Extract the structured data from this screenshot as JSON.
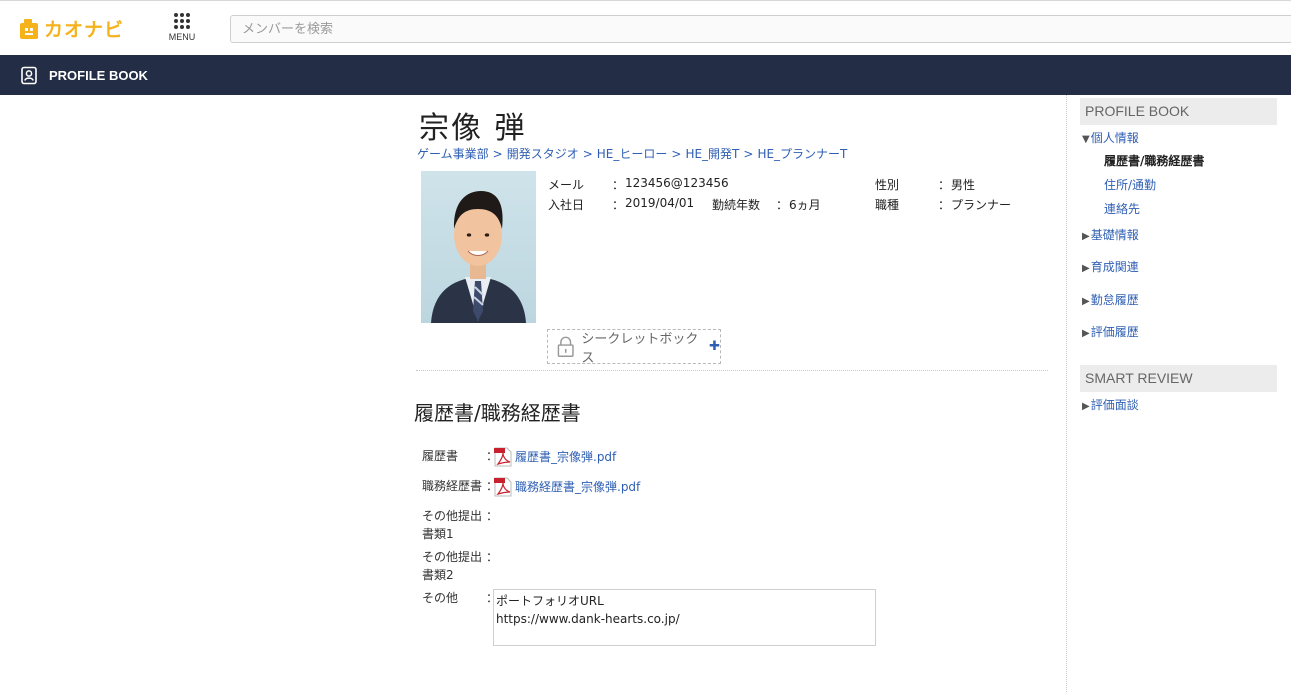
{
  "header": {
    "logo_text": "カオナビ",
    "menu_label": "MENU",
    "search_placeholder": "メンバーを検索"
  },
  "navbar": {
    "title": "PROFILE BOOK"
  },
  "profile": {
    "name": "宗像 弾",
    "breadcrumb": [
      "ゲーム事業部",
      "開発スタジオ",
      "HE_ヒーロー",
      "HE_開発T",
      "HE_プランナーT"
    ],
    "breadcrumb_sep": ">",
    "fields": {
      "email_label": "メール",
      "email_value": "123456@123456",
      "join_label": "入社日",
      "join_value": "2019/04/01",
      "tenure_label": "勤続年数",
      "tenure_value": "6ヵ月",
      "gender_label": "性別",
      "gender_value": "男性",
      "job_label": "職種",
      "job_value": "プランナー",
      "colon": "："
    },
    "secret_box_label": "シークレットボックス",
    "secret_box_plus": "✚"
  },
  "section": {
    "title": "履歴書/職務経歴書",
    "rows": [
      {
        "label": "履歴書",
        "value": "履歴書_宗像弾.pdf",
        "type": "pdf"
      },
      {
        "label": "職務経歴書",
        "value": "職務経歴書_宗像弾.pdf",
        "type": "pdf"
      },
      {
        "label": "その他提出書類1",
        "value": "",
        "type": "empty"
      },
      {
        "label": "その他提出書類2",
        "value": "",
        "type": "empty"
      },
      {
        "label": "その他",
        "value": "ポートフォリオURL\nhttps://www.dank-hearts.co.jp/",
        "type": "text"
      }
    ]
  },
  "sidebar": {
    "profile_book_head": "PROFILE BOOK",
    "personal": "個人情報",
    "personal_subs": [
      "履歴書/職務経歴書",
      "住所/通勤",
      "連絡先"
    ],
    "basic": "基礎情報",
    "training": "育成関連",
    "attendance": "勤怠履歴",
    "evaluation": "評価履歴",
    "smart_review_head": "SMART REVIEW",
    "interview": "評価面談",
    "tri_open": "▼",
    "tri_closed": "▶"
  },
  "colors": {
    "navbar_bg": "#232d45",
    "link": "#2f5fb3",
    "logo": "#f5b21a"
  }
}
